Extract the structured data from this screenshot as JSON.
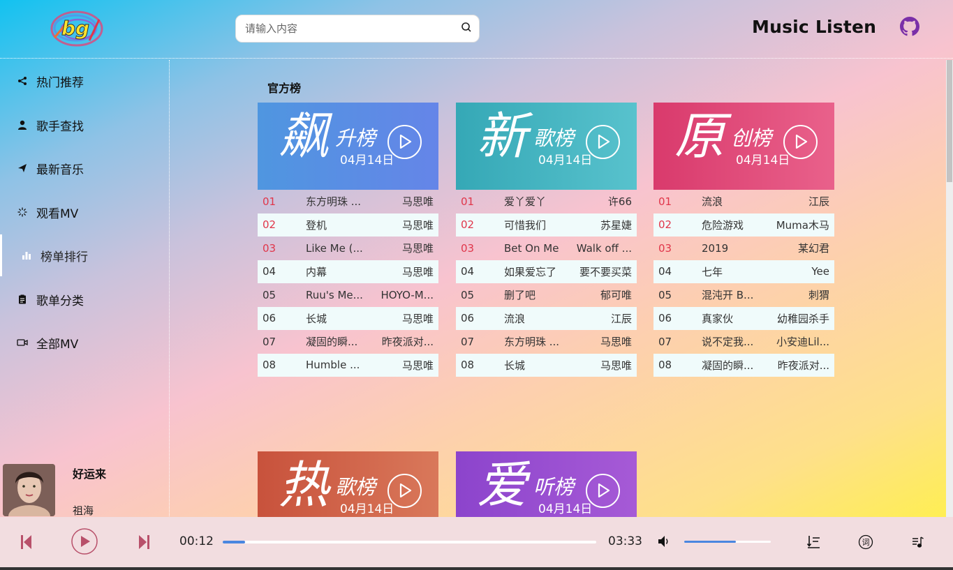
{
  "header": {
    "logo_text": "bg",
    "search_placeholder": "请输入内容",
    "app_title": "Music Listen",
    "github_icon": "github-icon"
  },
  "sidebar": {
    "items": [
      {
        "label": "热门推荐",
        "icon": "share-icon"
      },
      {
        "label": "歌手查找",
        "icon": "user-icon"
      },
      {
        "label": "最新音乐",
        "icon": "send-icon"
      },
      {
        "label": "观看MV",
        "icon": "loading-icon"
      },
      {
        "label": "榜单排行",
        "icon": "bar-chart-icon",
        "active": true
      },
      {
        "label": "歌单分类",
        "icon": "clipboard-icon"
      },
      {
        "label": "全部MV",
        "icon": "video-camera-icon"
      }
    ]
  },
  "now_playing": {
    "title": "好运来",
    "artist": "祖海"
  },
  "main": {
    "section_title": "官方榜",
    "charts": [
      {
        "big_char": "飙",
        "subtitle": "升榜",
        "date": "04月14日",
        "color": "#5a8fe6",
        "rows": [
          {
            "rank": "01",
            "song": "东方明珠 ...",
            "artist": "马思唯"
          },
          {
            "rank": "02",
            "song": "登机",
            "artist": "马思唯"
          },
          {
            "rank": "03",
            "song": "Like Me (...",
            "artist": "马思唯"
          },
          {
            "rank": "04",
            "song": "内幕",
            "artist": "马思唯"
          },
          {
            "rank": "05",
            "song": "Ruu's Me...",
            "artist": "HOYO-M..."
          },
          {
            "rank": "06",
            "song": "长城",
            "artist": "马思唯"
          },
          {
            "rank": "07",
            "song": "凝固的瞬...",
            "artist": "昨夜派对..."
          },
          {
            "rank": "08",
            "song": "Humble ...",
            "artist": "马思唯"
          }
        ]
      },
      {
        "big_char": "新",
        "subtitle": "歌榜",
        "date": "04月14日",
        "color": "#3fb0bf",
        "rows": [
          {
            "rank": "01",
            "song": "爱丫爱丫",
            "artist": "许66"
          },
          {
            "rank": "02",
            "song": "可惜我们",
            "artist": "苏星婕"
          },
          {
            "rank": "03",
            "song": "Bet On Me",
            "artist": "Walk off ..."
          },
          {
            "rank": "04",
            "song": "如果爱忘了",
            "artist": "要不要买菜"
          },
          {
            "rank": "05",
            "song": "删了吧",
            "artist": "郁可唯"
          },
          {
            "rank": "06",
            "song": "流浪",
            "artist": "江辰"
          },
          {
            "rank": "07",
            "song": "东方明珠 ...",
            "artist": "马思唯"
          },
          {
            "rank": "08",
            "song": "长城",
            "artist": "马思唯"
          }
        ]
      },
      {
        "big_char": "原",
        "subtitle": "创榜",
        "date": "04月14日",
        "color": "#e0467a",
        "rows": [
          {
            "rank": "01",
            "song": "流浪",
            "artist": "江辰"
          },
          {
            "rank": "02",
            "song": "危险游戏",
            "artist": "Muma木马"
          },
          {
            "rank": "03",
            "song": "2019",
            "artist": "某幻君"
          },
          {
            "rank": "04",
            "song": "七年",
            "artist": "Yee"
          },
          {
            "rank": "05",
            "song": "混沌开 B...",
            "artist": "刺猬"
          },
          {
            "rank": "06",
            "song": "真家伙",
            "artist": "幼稚园杀手"
          },
          {
            "rank": "07",
            "song": "说不定我...",
            "artist": "小安迪Lil..."
          },
          {
            "rank": "08",
            "song": "凝固的瞬...",
            "artist": "昨夜派对..."
          }
        ]
      },
      {
        "big_char": "热",
        "subtitle": "歌榜",
        "date": "04月14日",
        "color": "#d0684a",
        "rows": []
      },
      {
        "big_char": "爱",
        "subtitle": "听榜",
        "date": "04月14日",
        "color": "#9b4fcf",
        "rows": []
      }
    ]
  },
  "player": {
    "current_time": "00:12",
    "total_time": "03:33",
    "progress_fraction": 0.06,
    "volume_fraction": 0.6,
    "controls": [
      "prev-icon",
      "play-icon",
      "next-icon",
      "volume-icon",
      "playlist-icon",
      "lyrics-icon",
      "music-list-icon"
    ],
    "lyrics_label": "词"
  }
}
